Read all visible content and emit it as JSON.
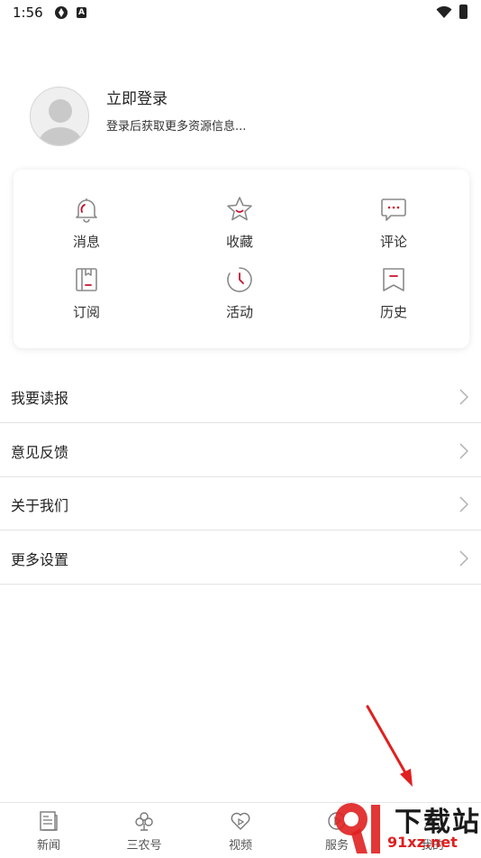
{
  "status_bar": {
    "time": "1:56"
  },
  "profile": {
    "title": "立即登录",
    "subtitle": "登录后获取更多资源信息..."
  },
  "features": [
    {
      "label": "消息",
      "icon": "bell-icon"
    },
    {
      "label": "收藏",
      "icon": "star-icon"
    },
    {
      "label": "评论",
      "icon": "comment-icon"
    },
    {
      "label": "订阅",
      "icon": "subscribe-icon"
    },
    {
      "label": "活动",
      "icon": "clock-icon"
    },
    {
      "label": "历史",
      "icon": "history-icon"
    }
  ],
  "menu": [
    {
      "label": "我要读报"
    },
    {
      "label": "意见反馈"
    },
    {
      "label": "关于我们"
    },
    {
      "label": "更多设置"
    }
  ],
  "bottom_nav": [
    {
      "label": "新闻",
      "icon": "news-icon"
    },
    {
      "label": "三农号",
      "icon": "clover-icon"
    },
    {
      "label": "视频",
      "icon": "video-heart-icon"
    },
    {
      "label": "服务",
      "icon": "service-icon"
    },
    {
      "label": "我的",
      "icon": "profile-icon"
    }
  ],
  "watermark": {
    "line1": "下载站",
    "line2": "91xz.net"
  },
  "colors": {
    "accent": "#c8102e",
    "icon_gray": "#8a8a8a",
    "watermark_red": "#e02020"
  }
}
